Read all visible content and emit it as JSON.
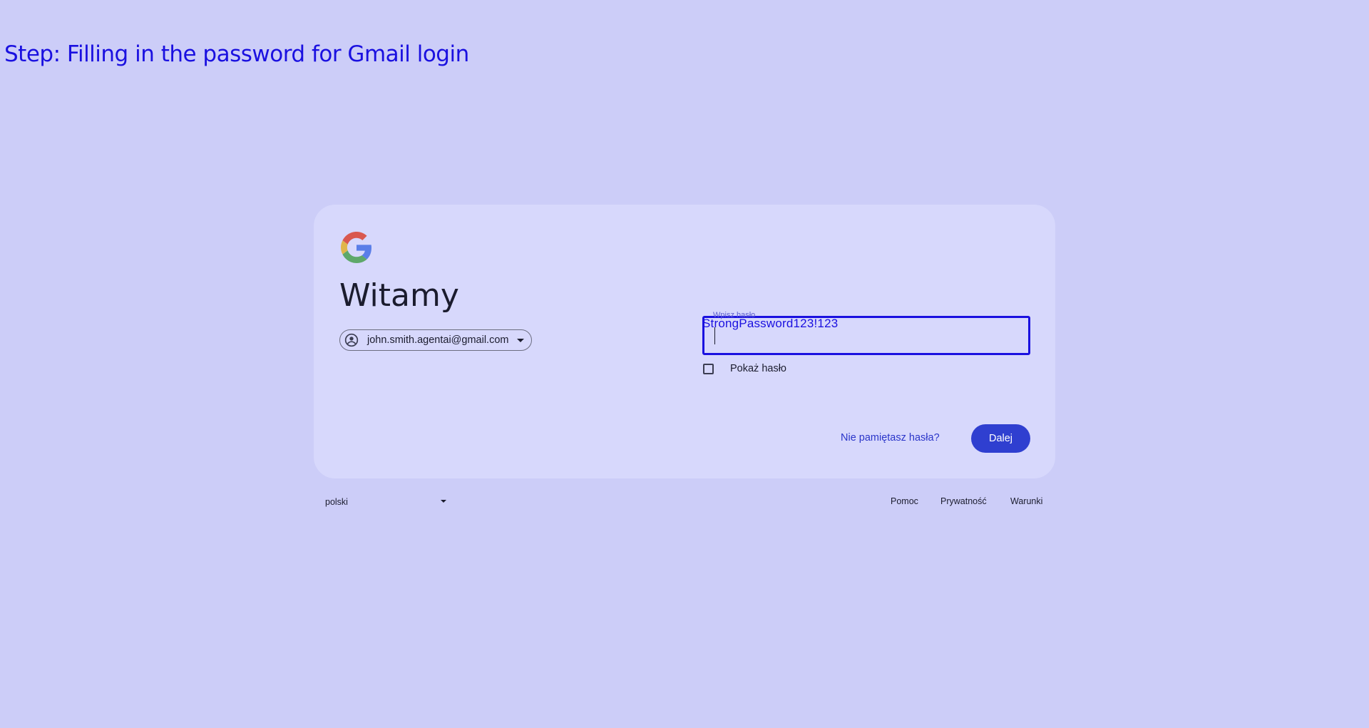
{
  "annotation": {
    "step_title": "Step: Filling in the password for Gmail login",
    "typed_value": "StrongPassword123!123"
  },
  "card": {
    "logo_icon": "google-g-icon",
    "heading": "Witamy",
    "account": {
      "email": "john.smith.agentai@gmail.com",
      "avatar_icon": "account-circle-icon",
      "dropdown_icon": "caret-down-icon"
    },
    "password": {
      "label": "Wpisz hasło",
      "value": ""
    },
    "show_password": {
      "label": "Pokaż hasło",
      "checked": false
    },
    "forgot_link": "Nie pamiętasz hasła?",
    "next_button": "Dalej"
  },
  "footer": {
    "language": "polski",
    "links": [
      "Pomoc",
      "Prywatność",
      "Warunki"
    ]
  },
  "colors": {
    "background": "#cccdf8",
    "card": "#d7d8fc",
    "accent": "#2f3fd0",
    "annotation": "#1a10e0"
  }
}
